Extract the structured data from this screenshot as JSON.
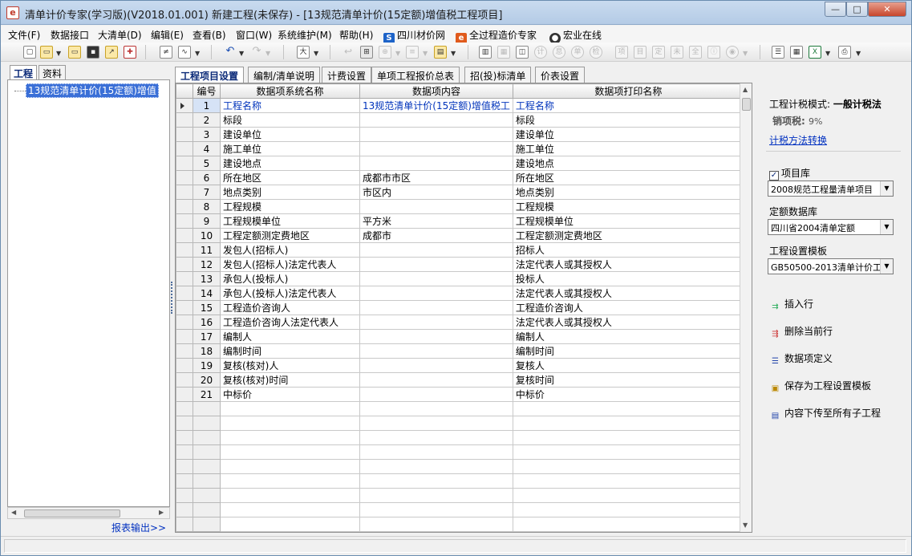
{
  "window": {
    "title": "清单计价专家(学习版)(V2018.01.001) 新建工程(未保存) - [13规范清单计价(15定额)增值税工程项目]",
    "controls": {
      "minimize": "—",
      "maximize": "□",
      "close": "✕"
    }
  },
  "menu": {
    "items": [
      "文件(F)",
      "数据接口",
      "大清单(D)",
      "编辑(E)",
      "查看(B)",
      "窗口(W)",
      "系统维护(M)",
      "帮助(H)"
    ],
    "links": [
      "四川材价网",
      "全过程造价专家",
      "宏业在线"
    ]
  },
  "left_panel": {
    "tabs": [
      "工程",
      "资料"
    ],
    "tree_node": "13规范清单计价(15定额)增值",
    "report_link": "报表输出>>"
  },
  "main_tabs": [
    "工程项目设置",
    "编制/清单说明",
    "计费设置",
    "单项工程报价总表",
    "招(投)标清单",
    "价表设置"
  ],
  "grid": {
    "headers": [
      "编号",
      "数据项系统名称",
      "数据项内容",
      "数据项打印名称"
    ],
    "rows": [
      {
        "num": "1",
        "name": "工程名称",
        "content": "13规范清单计价(15定额)增值税工",
        "print": "工程名称"
      },
      {
        "num": "2",
        "name": "标段",
        "content": "",
        "print": "标段"
      },
      {
        "num": "3",
        "name": "建设单位",
        "content": "",
        "print": "建设单位"
      },
      {
        "num": "4",
        "name": "施工单位",
        "content": "",
        "print": "施工单位"
      },
      {
        "num": "5",
        "name": "建设地点",
        "content": "",
        "print": "建设地点"
      },
      {
        "num": "6",
        "name": "所在地区",
        "content": "成都市市区",
        "print": "所在地区"
      },
      {
        "num": "7",
        "name": "地点类别",
        "content": "市区内",
        "print": "地点类别"
      },
      {
        "num": "8",
        "name": "工程规模",
        "content": "",
        "print": "工程规模"
      },
      {
        "num": "9",
        "name": "工程规模单位",
        "content": "平方米",
        "print": "工程规模单位"
      },
      {
        "num": "10",
        "name": "工程定额测定费地区",
        "content": "成都市",
        "print": "工程定额测定费地区"
      },
      {
        "num": "11",
        "name": "发包人(招标人)",
        "content": "",
        "print": "招标人"
      },
      {
        "num": "12",
        "name": "发包人(招标人)法定代表人",
        "content": "",
        "print": "法定代表人或其授权人"
      },
      {
        "num": "13",
        "name": "承包人(投标人)",
        "content": "",
        "print": "投标人"
      },
      {
        "num": "14",
        "name": "承包人(投标人)法定代表人",
        "content": "",
        "print": "法定代表人或其授权人"
      },
      {
        "num": "15",
        "name": "工程造价咨询人",
        "content": "",
        "print": "工程造价咨询人"
      },
      {
        "num": "16",
        "name": "工程造价咨询人法定代表人",
        "content": "",
        "print": "法定代表人或其授权人"
      },
      {
        "num": "17",
        "name": "编制人",
        "content": "",
        "print": "编制人"
      },
      {
        "num": "18",
        "name": "编制时间",
        "content": "",
        "print": "编制时间"
      },
      {
        "num": "19",
        "name": "复核(核对)人",
        "content": "",
        "print": "复核人"
      },
      {
        "num": "20",
        "name": "复核(核对)时间",
        "content": "",
        "print": "复核时间"
      },
      {
        "num": "21",
        "name": "中标价",
        "content": "",
        "print": "中标价"
      }
    ]
  },
  "right_panel": {
    "tax_mode_label": "工程计税模式:",
    "tax_mode_value": "一般计税法",
    "vat_label": "销项税:",
    "vat_value": "9%",
    "tax_switch_link": "计税方法转换",
    "item_lib_label": "项目库",
    "item_lib_checked": true,
    "item_lib_value": "2008规范工程量清单项目",
    "quota_db_label": "定额数据库",
    "quota_db_value": "四川省2004清单定额",
    "template_label": "工程设置模板",
    "template_value": "GB50500-2013清单计价工",
    "actions": [
      "插入行",
      "删除当前行",
      "数据项定义",
      "保存为工程设置模板",
      "内容下传至所有子工程"
    ]
  },
  "colors": {
    "link": "#0030c0",
    "selection": "#3a6fd7",
    "accent_text": "#0b2a78"
  }
}
